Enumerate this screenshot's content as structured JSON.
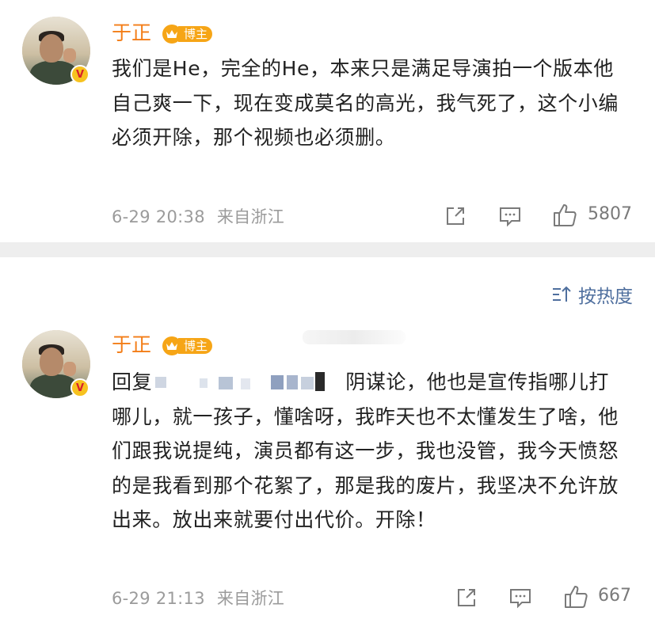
{
  "posts": [
    {
      "author": "于正",
      "badge_label": "博主",
      "verified_icon": "verified-v-icon",
      "content": "我们是He，完全的He，本来只是满足导演拍一个版本他自己爽一下，现在变成莫名的高光，我气死了，这个小编必须开除，那个视频也必须删。",
      "time": "6-29 20:38",
      "location": "来自浙江",
      "likes": "5807"
    },
    {
      "author": "于正",
      "badge_label": "博主",
      "verified_icon": "verified-v-icon",
      "content_prefix": "回复",
      "content": "阴谋论，他也是宣传指哪儿打哪儿，就一孩子，懂啥呀，我昨天也不太懂发生了啥，他们跟我说提纯，演员都有这一步，我也没管，我今天愤怒的是我看到那个花絮了，那是我的废片，我坚决不允许放出来。放出来就要付出代价。开除！",
      "time": "6-29 21:13",
      "location": "来自浙江",
      "likes": "667"
    }
  ],
  "sort": {
    "label": "按热度",
    "icon": "sort-icon"
  },
  "icons": [
    "share-icon",
    "comment-icon",
    "like-icon",
    "crown-icon"
  ],
  "colors": {
    "author": "#f37d17",
    "badge": "#f6a516",
    "link": "#4f6f9e",
    "meta": "#9b9b9b",
    "divider": "#eeeeee"
  }
}
